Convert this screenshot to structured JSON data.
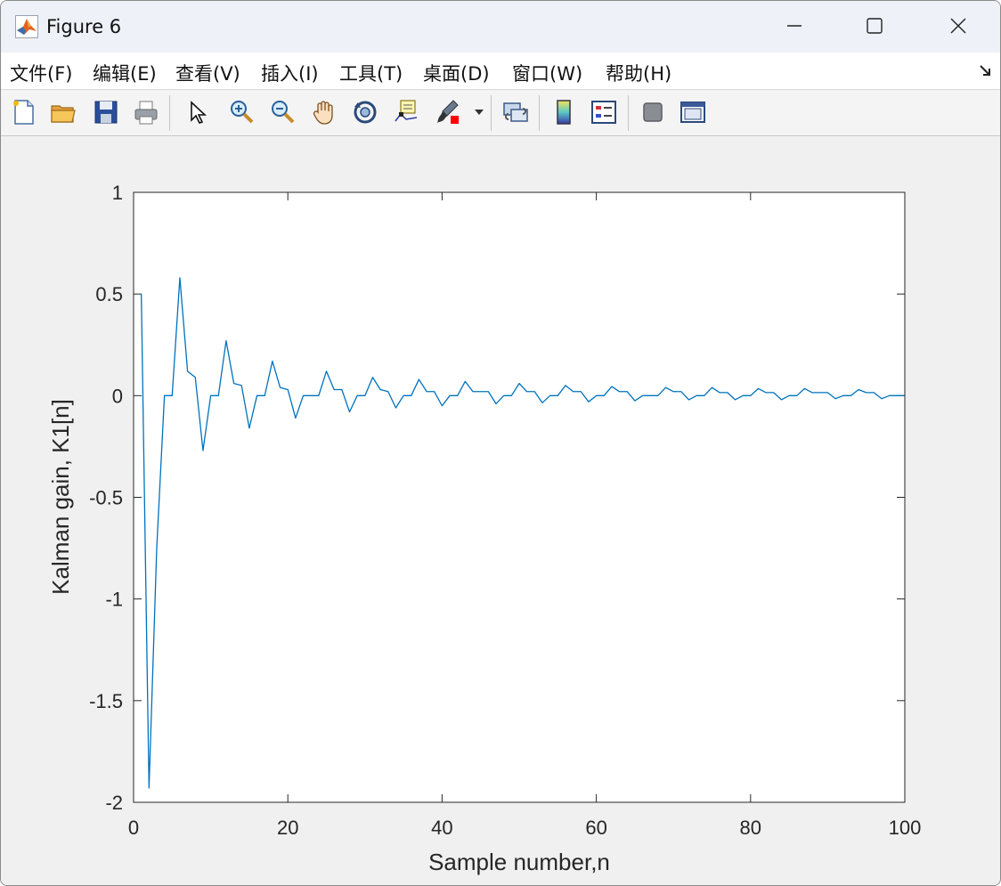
{
  "window": {
    "title": "Figure 6",
    "icon": "matlab-logo-icon",
    "controls": [
      "minimize-icon",
      "maximize-icon",
      "close-icon"
    ]
  },
  "menu": {
    "file": "文件(F)",
    "edit": "编辑(E)",
    "view": "查看(V)",
    "insert": "插入(I)",
    "tools": "工具(T)",
    "desktop": "桌面(D)",
    "window": "窗口(W)",
    "help": "帮助(H)"
  },
  "toolbar": {
    "icons": [
      "new-figure-icon",
      "open-file-icon",
      "save-figure-icon",
      "print-figure-icon",
      "edit-plot-icon",
      "zoom-in-icon",
      "zoom-out-icon",
      "pan-icon",
      "rotate-3d-icon",
      "data-cursor-icon",
      "brush-icon",
      "brush-dropdown-icon",
      "link-plot-icon",
      "insert-colorbar-icon",
      "insert-legend-icon",
      "hide-plot-tools-icon",
      "show-plot-tools-icon"
    ]
  },
  "colors": {
    "line": "#0072bd",
    "axes_bg": "#ffffff",
    "figure_bg": "#f0f0f0",
    "brush_red": "#ff0000"
  },
  "chart_data": {
    "type": "line",
    "title": "",
    "xlabel": "Sample number,n",
    "ylabel": "Kalman gain, K1[n]",
    "xlim": [
      0,
      100
    ],
    "ylim": [
      -2,
      1
    ],
    "xticks": [
      0,
      20,
      40,
      60,
      80,
      100
    ],
    "yticks": [
      -2,
      -1.5,
      -1,
      -0.5,
      0,
      0.5,
      1
    ],
    "xtick_labels": [
      "0",
      "20",
      "40",
      "60",
      "80",
      "100"
    ],
    "ytick_labels": [
      "-2",
      "-1.5",
      "-1",
      "-0.5",
      "0",
      "0.5",
      "1"
    ],
    "grid": false,
    "series": [
      {
        "x": [
          1,
          2,
          3,
          4,
          5,
          6,
          7,
          8,
          9,
          10,
          11,
          12,
          13,
          14,
          15,
          16,
          17,
          18,
          19,
          20,
          21,
          22,
          23,
          24,
          25,
          26,
          27,
          28,
          29,
          30,
          31,
          32,
          33,
          34,
          35,
          36,
          37,
          38,
          39,
          40,
          41,
          42,
          43,
          44,
          45,
          46,
          47,
          48,
          49,
          50,
          51,
          52,
          53,
          54,
          55,
          56,
          57,
          58,
          59,
          60,
          61,
          62,
          63,
          64,
          65,
          66,
          67,
          68,
          69,
          70,
          71,
          72,
          73,
          74,
          75,
          76,
          77,
          78,
          79,
          80,
          81,
          82,
          83,
          84,
          85,
          86,
          87,
          88,
          89,
          90,
          91,
          92,
          93,
          94,
          95,
          96,
          97,
          98,
          99,
          100
        ],
        "values": [
          0.5,
          -1.93,
          -0.75,
          0,
          0,
          0.58,
          0.12,
          0.09,
          -0.27,
          0,
          0,
          0.27,
          0.06,
          0.05,
          -0.16,
          0,
          0,
          0.17,
          0.04,
          0.03,
          -0.11,
          0,
          0,
          0,
          0.12,
          0.03,
          0.03,
          -0.08,
          0,
          0,
          0.09,
          0.03,
          0.02,
          -0.06,
          0,
          0,
          0.08,
          0.02,
          0.02,
          -0.05,
          0,
          0,
          0.07,
          0.02,
          0.02,
          0.02,
          -0.04,
          0,
          0,
          0.06,
          0.02,
          0.02,
          -0.035,
          0,
          0,
          0.05,
          0.02,
          0.02,
          -0.03,
          0,
          0,
          0.045,
          0.02,
          0.02,
          -0.025,
          0,
          0,
          0,
          0.04,
          0.02,
          0.02,
          -0.02,
          0,
          0,
          0.04,
          0.015,
          0.015,
          -0.02,
          0,
          0,
          0.035,
          0.015,
          0.015,
          -0.02,
          0,
          0,
          0.035,
          0.015,
          0.015,
          0.015,
          -0.015,
          0,
          0,
          0.03,
          0.015,
          0.015,
          -0.015,
          0,
          0,
          0
        ]
      }
    ]
  }
}
